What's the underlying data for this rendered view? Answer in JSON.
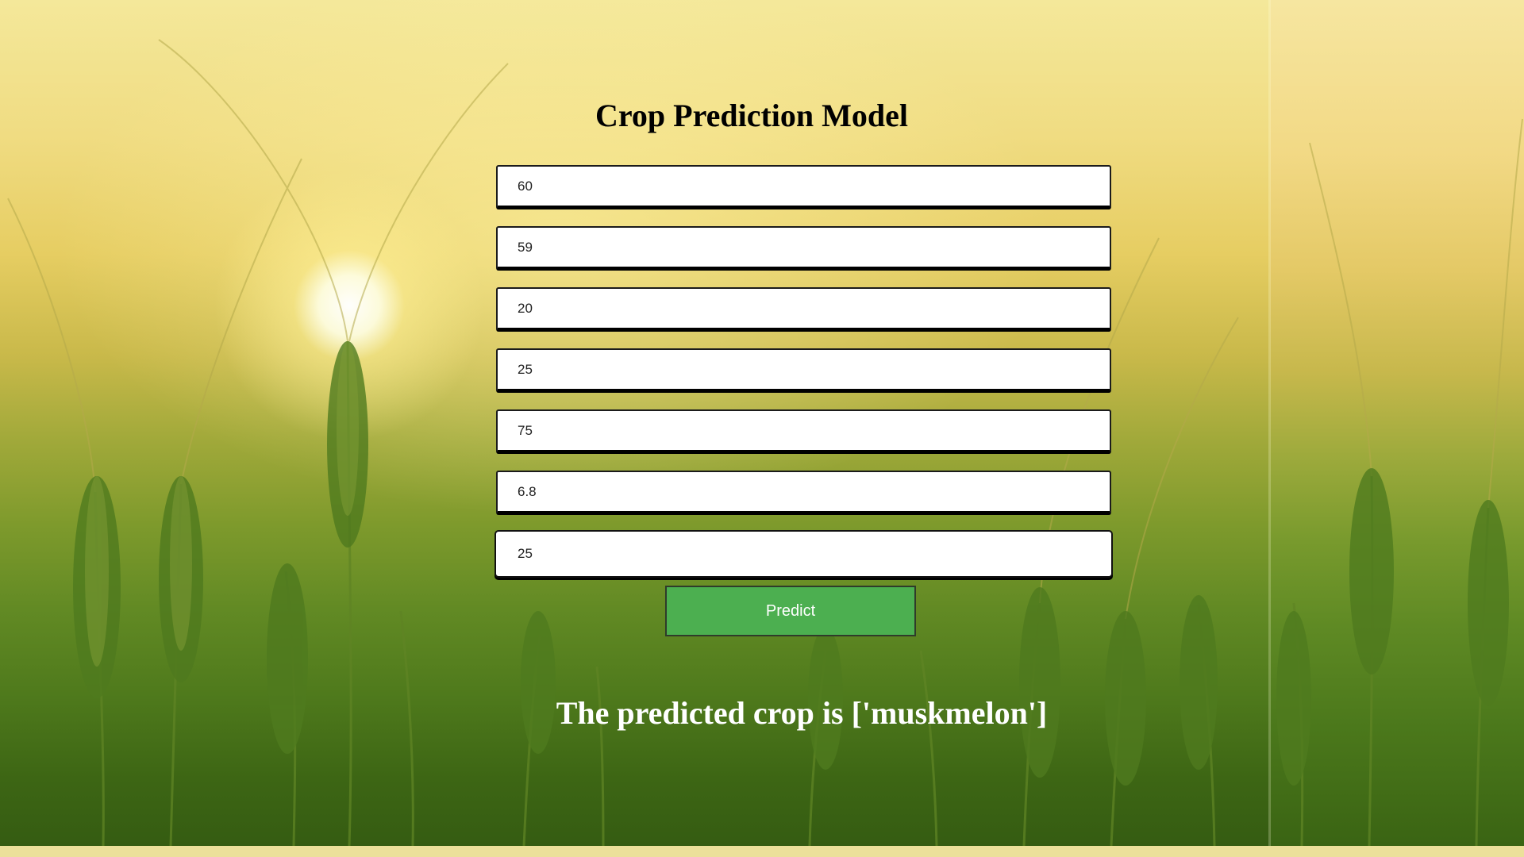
{
  "title": "Crop Prediction Model",
  "fields": [
    {
      "value": "60"
    },
    {
      "value": "59"
    },
    {
      "value": "20"
    },
    {
      "value": "25"
    },
    {
      "value": "75"
    },
    {
      "value": "6.8"
    },
    {
      "value": "25"
    }
  ],
  "predict_button": {
    "label": "Predict",
    "color": "#4caf50"
  },
  "result": "The predicted crop is ['muskmelon']",
  "background": {
    "description_icon": "wheat-field-image",
    "sun_color": "#ffffff"
  }
}
